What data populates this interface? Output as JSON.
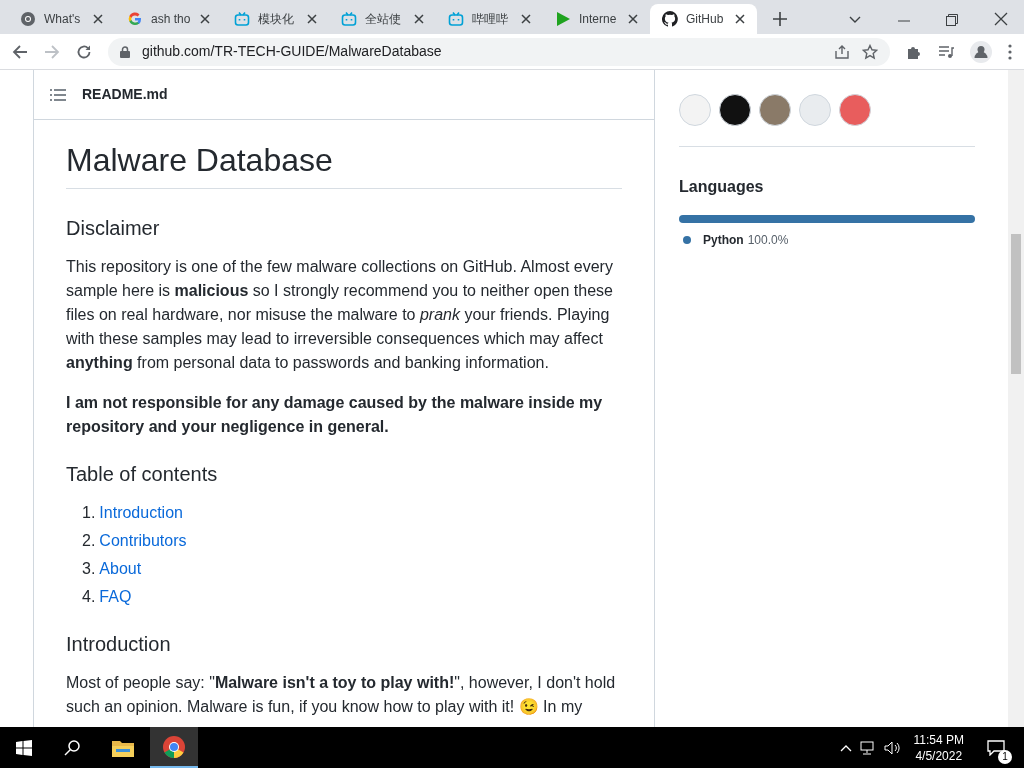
{
  "browser": {
    "tabs": [
      {
        "title": "What's",
        "kind": "chrome",
        "selected": false
      },
      {
        "title": "ash tho",
        "kind": "google",
        "selected": false
      },
      {
        "title": "模块化",
        "kind": "tv",
        "selected": false
      },
      {
        "title": "全站使",
        "kind": "tv",
        "selected": false
      },
      {
        "title": "哔哩哔",
        "kind": "tv",
        "selected": false
      },
      {
        "title": "Interne",
        "kind": "play",
        "selected": false
      },
      {
        "title": "GitHub",
        "kind": "github",
        "selected": true
      }
    ],
    "url": "github.com/TR-TECH-GUIDE/MalwareDatabase"
  },
  "readme": {
    "file": "README.md",
    "title": "Malware Database",
    "disclaimer": {
      "heading": "Disclaimer",
      "paragraphs": [
        "This repository is one of the few malware collections on GitHub. Almost every sample here is **malicious** so I strongly recommend you to neither open these files on real hardware, nor misuse the malware to *prank* your friends. Playing with these samples may lead to irreversible consequences which may affect **anything** from personal data to passwords and banking information.",
        "**I am not responsible for any damage caused by the malware inside my repository and your negligence in general.**"
      ]
    },
    "toc": {
      "heading": "Table of contents",
      "items": [
        {
          "number": "1.",
          "label": "Introduction"
        },
        {
          "number": "2.",
          "label": "Contributors"
        },
        {
          "number": "3.",
          "label": "About"
        },
        {
          "number": "4.",
          "label": "FAQ"
        }
      ]
    },
    "introduction": {
      "heading": "Introduction",
      "paragraph": "Most of people say: \"**Malware isn't a toy to play with!**\", however, I don't hold such an opinion. Malware is fun, if you know how to play with it! 😉 In my"
    }
  },
  "sidebar": {
    "languages": {
      "heading": "Languages",
      "level": 1.0,
      "items": [
        {
          "name": "Python",
          "percent": "100.0%",
          "color": "#3572a5"
        }
      ]
    }
  },
  "taskbar": {
    "time": "11:54 PM",
    "date": "4/5/2022",
    "notifications": "1"
  }
}
